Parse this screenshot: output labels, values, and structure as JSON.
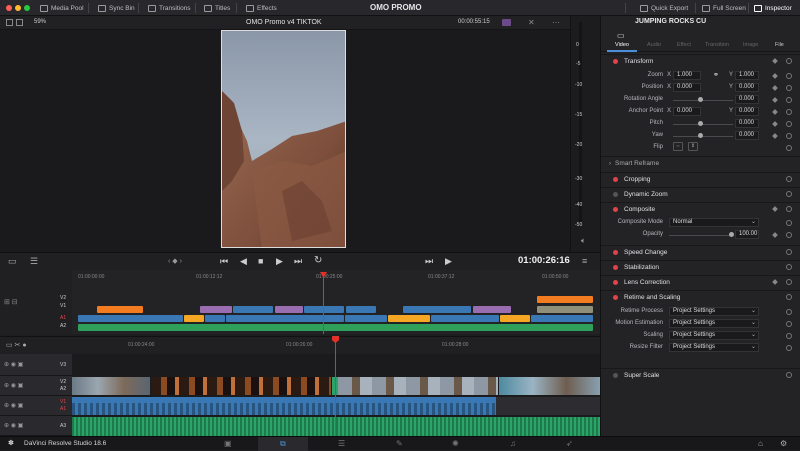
{
  "topbar": {
    "project_title": "OMO PROMO",
    "media_pool": "Media Pool",
    "sync_bin": "Sync Bin",
    "transitions": "Transitions",
    "titles": "Titles",
    "effects": "Effects",
    "quick_export": "Quick Export",
    "full_screen": "Full Screen",
    "inspector": "Inspector"
  },
  "viewer": {
    "zoom": "59%",
    "timeline_name": "OMO Promo v4 TIKTOK",
    "duration": "00:00:55:15",
    "timecode": "01:00:26:16"
  },
  "timeline_top": {
    "ruler": [
      "01:00:00:00",
      "01:00:12:12",
      "01:00:25:00",
      "01:00:37:12",
      "01:00:50:00"
    ],
    "track_labels": [
      "V2",
      "V1",
      "A1",
      "A2"
    ]
  },
  "timeline_detail": {
    "ruler": [
      "01:00:24:00",
      "01:00:26:00",
      "01:00:28:00"
    ],
    "tracks": [
      "V3",
      "V2",
      "A2",
      "V1",
      "A1",
      "A3"
    ]
  },
  "inspector": {
    "clip_name": "JUMPING ROCKS CU",
    "tabs": [
      "Video",
      "Audio",
      "Effect",
      "Transition",
      "Image",
      "File"
    ],
    "transform": {
      "title": "Transform",
      "zoom_label": "Zoom",
      "zoom_x": "1.000",
      "zoom_y": "1.000",
      "position_label": "Position",
      "pos_x": "0.000",
      "pos_y": "0.000",
      "rotation_label": "Rotation Angle",
      "rotation": "0.000",
      "anchor_label": "Anchor Point",
      "anchor_x": "0.000",
      "anchor_y": "0.000",
      "pitch_label": "Pitch",
      "pitch": "0.000",
      "yaw_label": "Yaw",
      "yaw": "0.000",
      "flip_label": "Flip",
      "x": "X",
      "y": "Y"
    },
    "smart_reframe": "Smart Reframe",
    "cropping": "Cropping",
    "dynamic_zoom": "Dynamic Zoom",
    "composite": {
      "title": "Composite",
      "mode_label": "Composite Mode",
      "mode_value": "Normal",
      "opacity_label": "Opacity",
      "opacity": "100.00"
    },
    "speed_change": "Speed Change",
    "stabilization": "Stabilization",
    "lens_correction": "Lens Correction",
    "retime": {
      "title": "Retime and Scaling",
      "process_label": "Retime Process",
      "process_value": "Project Settings",
      "motion_label": "Motion Estimation",
      "motion_value": "Project Settings",
      "scaling_label": "Scaling",
      "scaling_value": "Project Settings",
      "resize_label": "Resize Filter",
      "resize_value": "Project Settings"
    },
    "super_scale": "Super Scale"
  },
  "meter": {
    "scale": [
      "0",
      "-5",
      "-10",
      "-15",
      "-20",
      "-30",
      "-40",
      "-50"
    ]
  },
  "bottombar": {
    "app_name": "DaVinci Resolve Studio 18.6"
  },
  "colors": {
    "accent_red": "#e0444a",
    "playhead": "#e0312a",
    "clip_blue": "#3a78b5",
    "clip_orange": "#f47c20",
    "clip_purple": "#9a6cb0",
    "clip_green": "#2fa05b",
    "clip_teal": "#2aa46a",
    "audio_green": "#1f7a4a"
  }
}
